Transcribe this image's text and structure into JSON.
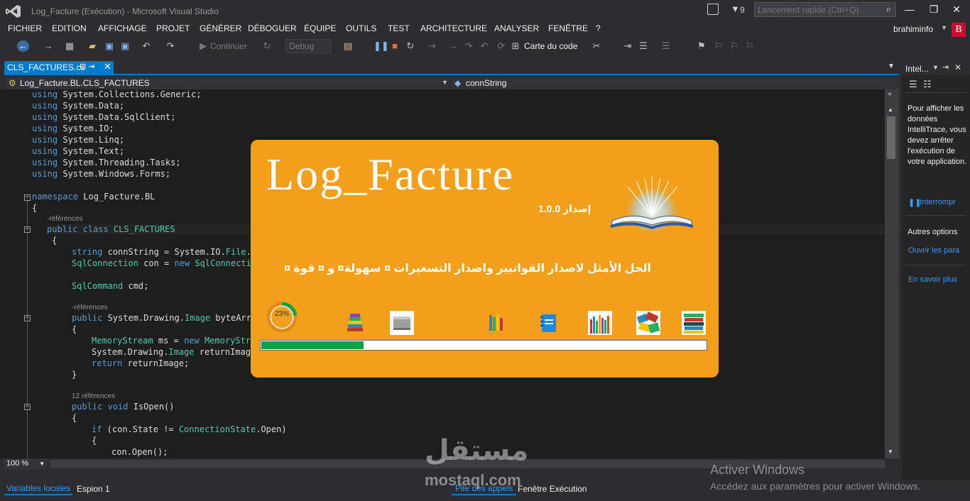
{
  "window": {
    "title": "Log_Facture (Exécution) - Microsoft Visual Studio",
    "notification_count": "9",
    "quick_launch_placeholder": "Lancement rapide (Ctrl+Q)",
    "minimize": "—",
    "restore": "❐",
    "close": "✕",
    "user_name": "brahiminfo",
    "user_initial": "B"
  },
  "menu": [
    "FICHIER",
    "EDITION",
    "AFFICHAGE",
    "PROJET",
    "GÉNÉRER",
    "DÉBOGUER",
    "ÉQUIPE",
    "OUTILS",
    "TEST",
    "ARCHITECTURE",
    "ANALYSER",
    "FENÊTRE",
    "?"
  ],
  "toolbar": {
    "continue_label": "Continuer",
    "configuration": "Debug",
    "code_map_label": "Carte du code"
  },
  "document_tab": {
    "label": "CLS_FACTURES.cs",
    "pin": "⊡ ⇥",
    "close": "✕"
  },
  "navigation": {
    "class_path": "Log_Facture.BL.CLS_FACTURES",
    "member": "connString"
  },
  "code": {
    "usings": [
      "System.Collections.Generic;",
      "System.Data;",
      "System.Data.SqlClient;",
      "System.IO;",
      "System.Linq;",
      "System.Text;",
      "System.Threading.Tasks;",
      "System.Windows.Forms;"
    ],
    "using_kw": "using",
    "namespace_kw": "namespace",
    "namespace_name": " Log_Facture.BL",
    "open_brace": "{",
    "close_brace": "}",
    "refs_plain": "-références",
    "refs_12": "12 références",
    "class_line_kw": "public class",
    "class_name": " CLS_FACTURES",
    "conn_kw": "string",
    "conn_rest": " connString = System.IO.",
    "conn_type": "File",
    "conn_tail": ".R",
    "sqlconn_type": "SqlConnection",
    "sqlconn_rest": " con = ",
    "sqlconn_new": "new",
    "sqlconn_tail": " SqlConnectio",
    "sqlcmd_type": "SqlCommand",
    "sqlcmd_rest": " cmd;",
    "public_kw": "public",
    "img_rest1": " System.Drawing.",
    "img_type": "Image",
    "img_rest2": " byteArra",
    "ms_type": "MemoryStream",
    "ms_rest": " ms = ",
    "ms_new": "new",
    "ms_tail": " MemoryStre",
    "ret_rest1": "System.Drawing.",
    "ret_type": "Image",
    "ret_rest2": " returnImage",
    "return_kw": "return",
    "return_rest": " returnImage;",
    "isopen_kw": "public void",
    "isopen_rest": " IsOpen()",
    "if_kw": "if",
    "if_rest": " (con.State != ",
    "if_type": "ConnectionState",
    "if_tail": ".Open)",
    "open_call": "con.Open();"
  },
  "editor": {
    "zoom": "100 %"
  },
  "right_panel": {
    "title": "Intel...",
    "message": "Pour afficher les données IntelliTrace, vous devez arrêter l'exécution de votre application.",
    "break_link": "Interrompr",
    "other_options": "Autres options",
    "open_settings": "Ouvrir les para",
    "learn_more": "En savoir plus"
  },
  "bottom_tabs": {
    "locals": "Variables locales",
    "watch": "Espion 1",
    "call_stack": "Pile des appels",
    "immediate": "Fenêtre Exécution"
  },
  "splash": {
    "title": "Log_Facture",
    "version": "إصدار 1.0.0",
    "tagline": "الحل الأمثل لاصدار الفواتيير واصدار التسعيرات ¤ سهولة¤ و ¤ قوة ¤",
    "progress_percent": 23,
    "progress_label": "23%",
    "accent": "#f29f1c",
    "progress_color": "#10a04a"
  },
  "watermarks": {
    "activate_title": "Activer Windows",
    "activate_sub": "Accédez aux paramètres pour activer Windows.",
    "site_ar": "مستقل",
    "site_en": "mostaql.com"
  },
  "colors": {
    "accent_blue": "#007acc",
    "keyword": "#569cd6",
    "type": "#4ec9b0",
    "editor_bg": "#1e1e1e"
  }
}
